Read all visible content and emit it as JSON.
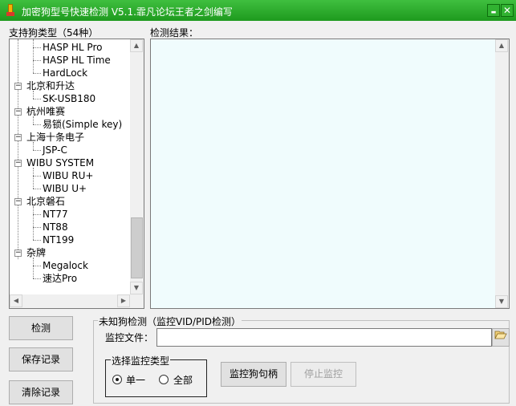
{
  "window": {
    "title": "加密狗型号快速检测 V5.1.霏凡论坛王者之剑编写",
    "minimize_glyph": "▬",
    "close_glyph": "✕"
  },
  "labels": {
    "supported_types": "支持狗类型（54种）",
    "results": "检测结果："
  },
  "tree": {
    "items": [
      {
        "text": "HASP HL Pro",
        "level": 1
      },
      {
        "text": "HASP HL Time",
        "level": 1
      },
      {
        "text": "HardLock",
        "level": 1
      },
      {
        "text": "北京和升达",
        "level": 0,
        "expanded": true
      },
      {
        "text": "SK-USB180",
        "level": 1
      },
      {
        "text": "杭州唯赛",
        "level": 0,
        "expanded": true
      },
      {
        "text": "易锁(Simple key)",
        "level": 1
      },
      {
        "text": "上海十条电子",
        "level": 0,
        "expanded": true
      },
      {
        "text": "JSP-C",
        "level": 1
      },
      {
        "text": "WIBU SYSTEM",
        "level": 0,
        "expanded": true
      },
      {
        "text": "WIBU RU+",
        "level": 1
      },
      {
        "text": "WIBU U+",
        "level": 1
      },
      {
        "text": "北京磐石",
        "level": 0,
        "expanded": true
      },
      {
        "text": "NT77",
        "level": 1
      },
      {
        "text": "NT88",
        "level": 1
      },
      {
        "text": "NT199",
        "level": 1
      },
      {
        "text": "杂牌",
        "level": 0,
        "expanded": true
      },
      {
        "text": "Megalock",
        "level": 1
      },
      {
        "text": "速达Pro",
        "level": 1
      }
    ],
    "expander_glyph": "−"
  },
  "buttons": {
    "detect": "检测",
    "save_log": "保存记录",
    "clear_log": "清除记录",
    "monitor_handle": "监控狗句柄",
    "stop_monitor": "停止监控"
  },
  "unknown_group": {
    "legend": "未知狗检测（监控VID/PID检测）",
    "file_label": "监控文件：",
    "file_value": "",
    "browse_icon": "folder-open-icon"
  },
  "monitor_type": {
    "legend": "选择监控类型",
    "options": [
      {
        "label": "单一",
        "selected": true
      },
      {
        "label": "全部",
        "selected": false
      }
    ]
  },
  "colors": {
    "titlebar": "#2aa62a",
    "result_bg": "#f0fcfd"
  }
}
